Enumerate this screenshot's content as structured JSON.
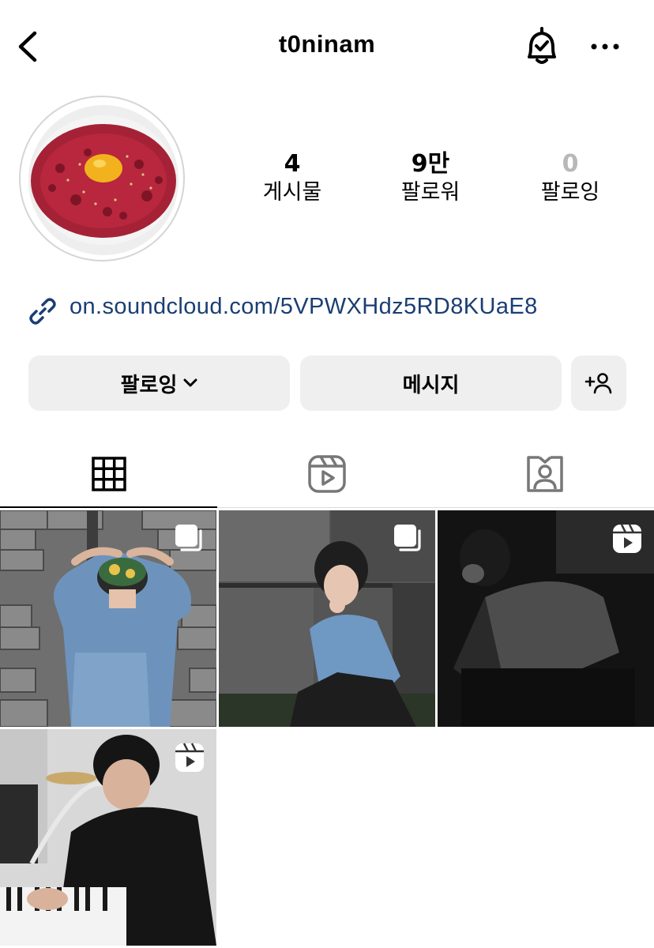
{
  "header": {
    "username": "t0ninam"
  },
  "stats": {
    "posts_count": "4",
    "posts_label": "게시물",
    "followers_count": "9만",
    "followers_label": "팔로워",
    "following_count": "0",
    "following_label": "팔로잉"
  },
  "bio": {
    "link": "on.soundcloud.com/5VPWXHdz5RD8KUaE8"
  },
  "actions": {
    "following_label": "팔로잉",
    "message_label": "메시지"
  },
  "tabs": [
    {
      "icon": "grid-icon",
      "active": true
    },
    {
      "icon": "reels-icon",
      "active": false
    },
    {
      "icon": "tagged-icon",
      "active": false
    }
  ],
  "posts": [
    {
      "badge": "carousel-icon"
    },
    {
      "badge": "carousel-icon"
    },
    {
      "badge": "reel-icon"
    },
    {
      "badge": "reel-icon"
    }
  ],
  "colors": {
    "link": "#1a3e73",
    "button_bg": "#efefef",
    "muted_count": "#b8b8b8"
  }
}
